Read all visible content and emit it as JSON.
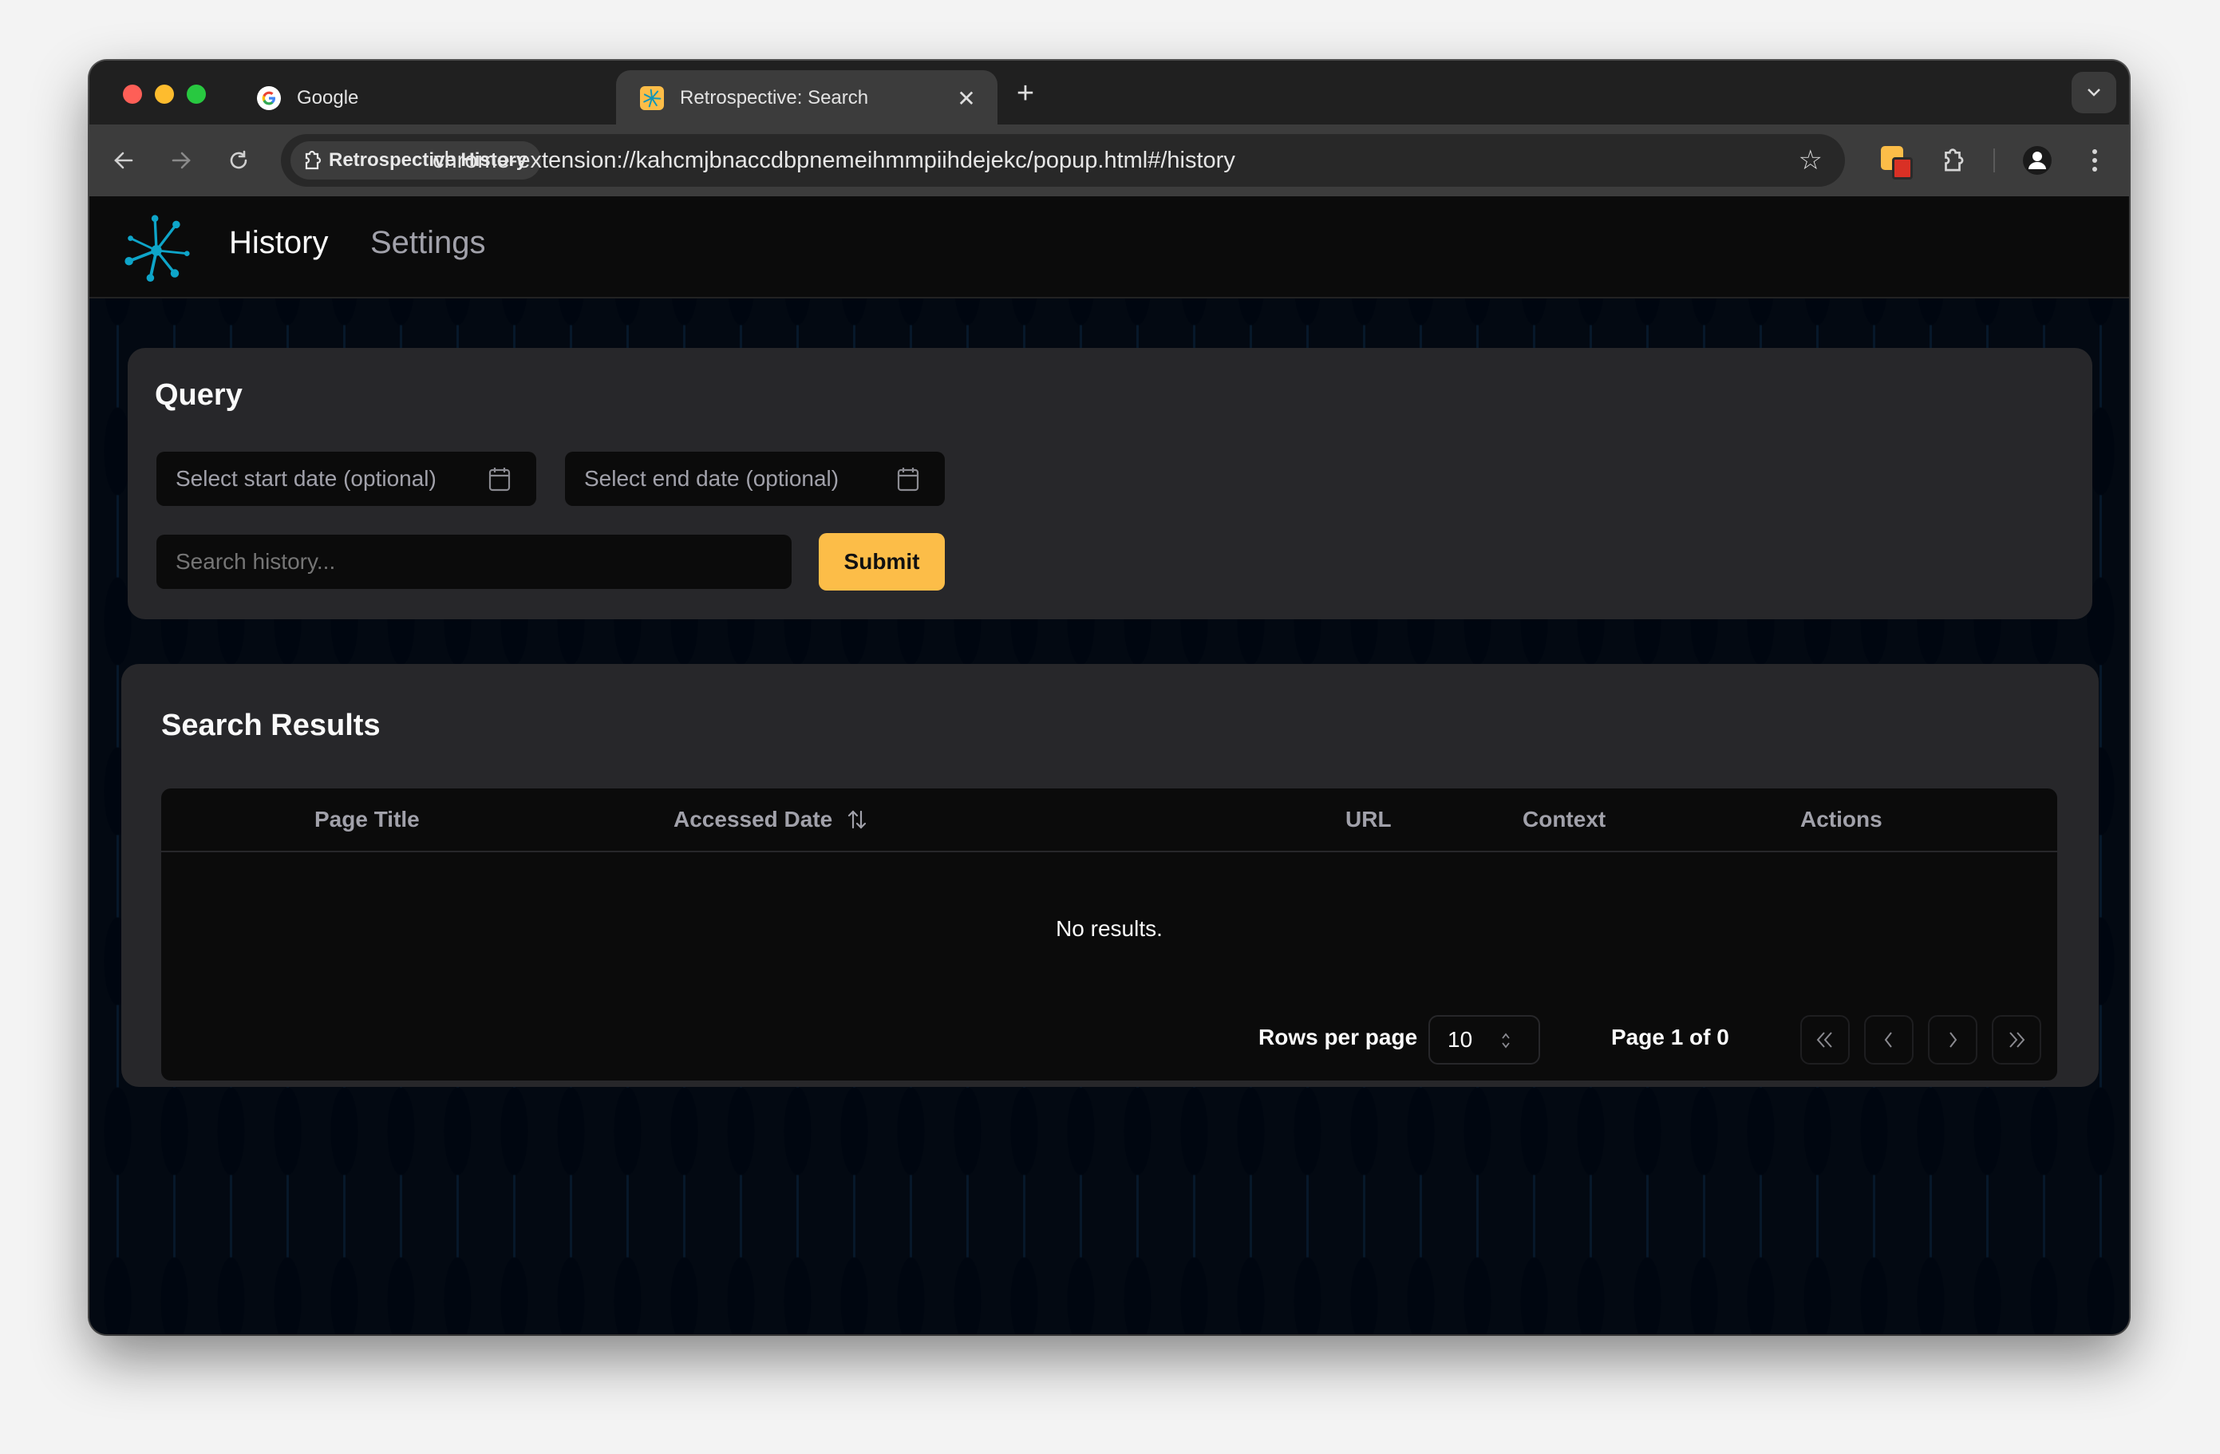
{
  "browser": {
    "tabs": [
      {
        "title": "Google",
        "favicon": "google-g-icon",
        "active": false
      },
      {
        "title": "Retrospective: Search",
        "favicon": "retrospective-logo-icon",
        "active": true
      }
    ],
    "new_tab_label": "+",
    "address_chip": "Retrospective History",
    "url": "chrome-extension://kahcmjbnaccdbpnemeihmmpiihdejekc/popup.html#/history"
  },
  "app": {
    "nav": [
      {
        "label": "History",
        "active": true
      },
      {
        "label": "Settings",
        "active": false
      }
    ],
    "accent": "#0ea5c9"
  },
  "query": {
    "title": "Query",
    "start_date_placeholder": "Select start date (optional)",
    "end_date_placeholder": "Select end date (optional)",
    "search_placeholder": "Search history...",
    "search_value": "",
    "submit_label": "Submit",
    "submit_color": "#fcbd48"
  },
  "results": {
    "title": "Search Results",
    "columns": [
      "Page Title",
      "Accessed Date",
      "URL",
      "Context",
      "Actions"
    ],
    "sortable_column": "Accessed Date",
    "rows": [],
    "empty_text": "No results.",
    "rows_per_page_label": "Rows per page",
    "rows_per_page_value": "10",
    "page_status": "Page 1 of 0"
  }
}
